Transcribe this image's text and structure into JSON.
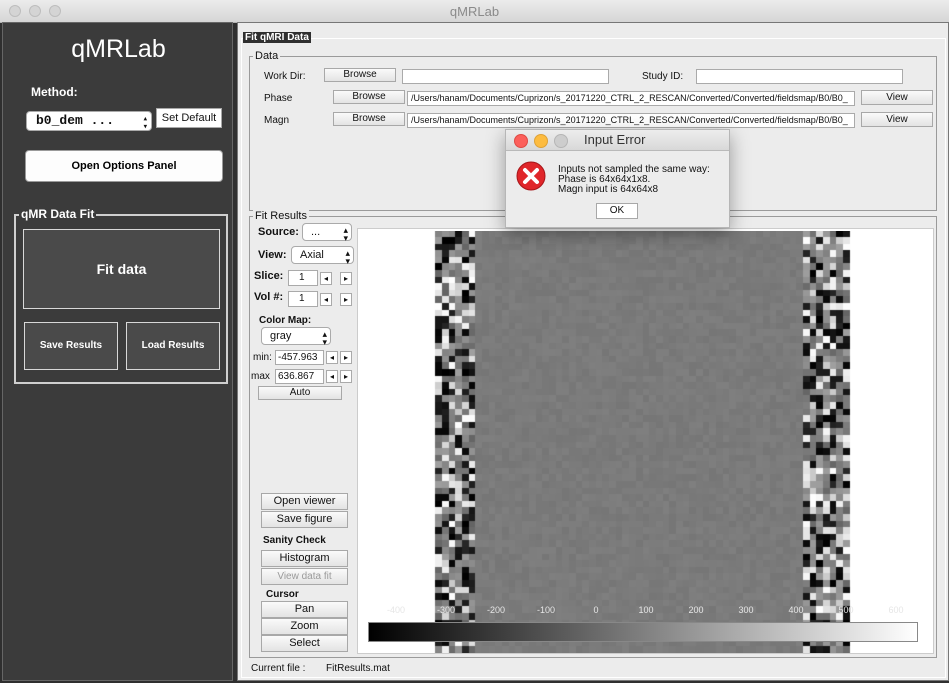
{
  "window": {
    "title": "qMRLab"
  },
  "left": {
    "app_name": "qMRLab",
    "method_label": "Method:",
    "method_value": "b0_dem ...",
    "set_default": "Set Default",
    "open_options": "Open Options Panel",
    "fit_group_title": "qMR Data Fit",
    "fit_data": "Fit data",
    "save_results": "Save Results",
    "load_results": "Load Results"
  },
  "fit_panel": {
    "title": "Fit qMRI Data",
    "data_title": "Data",
    "workdir_label": "Work Dir:",
    "browse": "Browse",
    "workdir_value": "",
    "study_label": "Study ID:",
    "study_value": "",
    "phase_label": "Phase",
    "phase_path": "/Users/hanam/Documents/Cuprizon/s_20171220_CTRL_2_RESCAN/Converted/Converted/fieldsmap/B0/B0_",
    "magn_label": "Magn",
    "magn_path": "/Users/hanam/Documents/Cuprizon/s_20171220_CTRL_2_RESCAN/Converted/Converted/fieldsmap/B0/B0_",
    "view": "View"
  },
  "results": {
    "title": "Fit Results",
    "source_label": "Source:",
    "source_value": "...",
    "view_label": "View:",
    "view_value": "Axial",
    "slice_label": "Slice:",
    "slice_value": "1",
    "vol_label": "Vol #:",
    "vol_value": "1",
    "colormap_label": "Color Map:",
    "colormap_value": "gray",
    "min_label": "min:",
    "min_value": "-457.963",
    "max_label": "max",
    "max_value": "636.867",
    "auto": "Auto",
    "open_viewer": "Open viewer",
    "save_figure": "Save figure",
    "sanity_label": "Sanity Check",
    "histogram": "Histogram",
    "view_data_fit": "View data fit",
    "cursor_label": "Cursor",
    "pan": "Pan",
    "zoom": "Zoom",
    "select": "Select",
    "current_file_label": "Current file :",
    "current_file_value": "FitResults.mat",
    "colorbar_ticks": [
      "-400",
      "-300",
      "-200",
      "-100",
      "0",
      "100",
      "200",
      "300",
      "400",
      "500",
      "600"
    ]
  },
  "dialog": {
    "title": "Input Error",
    "line1": "Inputs not sampled the same way:",
    "line2": "Phase is 64x64x1x8.",
    "line3": "Magn input is  64x64x8",
    "ok": "OK"
  },
  "colors": {
    "error_red": "#e0262a",
    "dark_bg": "#3b3b3b",
    "panel_bg": "#ececec"
  }
}
